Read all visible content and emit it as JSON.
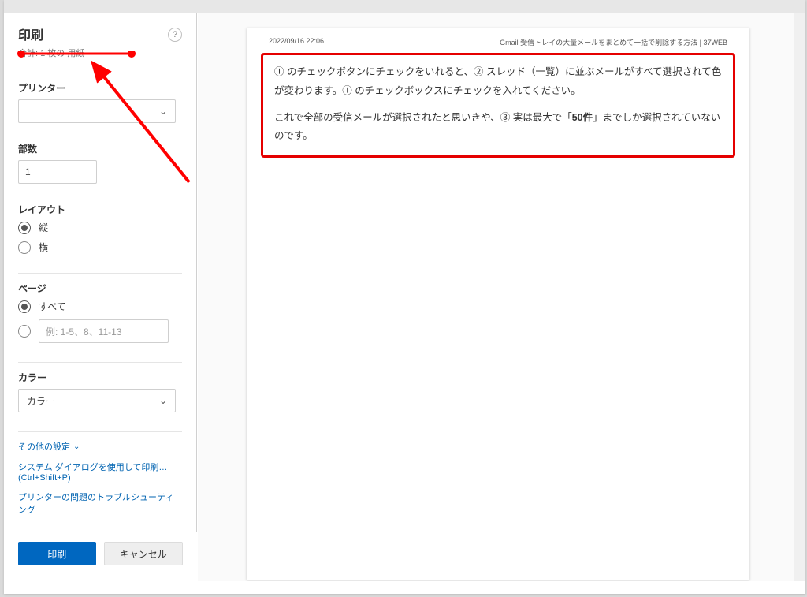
{
  "dialog": {
    "title": "印刷",
    "total": "合計: 1 枚の 用紙"
  },
  "sections": {
    "printer": {
      "label": "プリンター",
      "value": ""
    },
    "copies": {
      "label": "部数",
      "value": "1"
    },
    "layout": {
      "label": "レイアウト",
      "options": {
        "portrait": "縦",
        "landscape": "横"
      },
      "selected": "portrait"
    },
    "pages": {
      "label": "ページ",
      "options": {
        "all": "すべて"
      },
      "custom_placeholder": "例: 1-5、8、11-13",
      "selected": "all"
    },
    "color": {
      "label": "カラー",
      "value": "カラー"
    }
  },
  "links": {
    "more": "その他の設定",
    "system": "システム ダイアログを使用して印刷… (Ctrl+Shift+P)",
    "troubleshoot": "プリンターの問題のトラブルシューティング"
  },
  "buttons": {
    "print": "印刷",
    "cancel": "キャンセル"
  },
  "preview": {
    "header_left": "2022/09/16 22:06",
    "header_right": "Gmail 受信トレイの大量メールをまとめて一括で削除する方法 | 37WEB",
    "para1": "① のチェックボタンにチェックをいれると、② スレッド（一覧）に並ぶメールがすべて選択されて色が変わります。① のチェックボックスにチェックを入れてください。",
    "para2a": "これで全部の受信メールが選択されたと思いきや、③ 実は最大で「",
    "para2b": "50件",
    "para2c": "」までしか選択されていないのです。"
  }
}
